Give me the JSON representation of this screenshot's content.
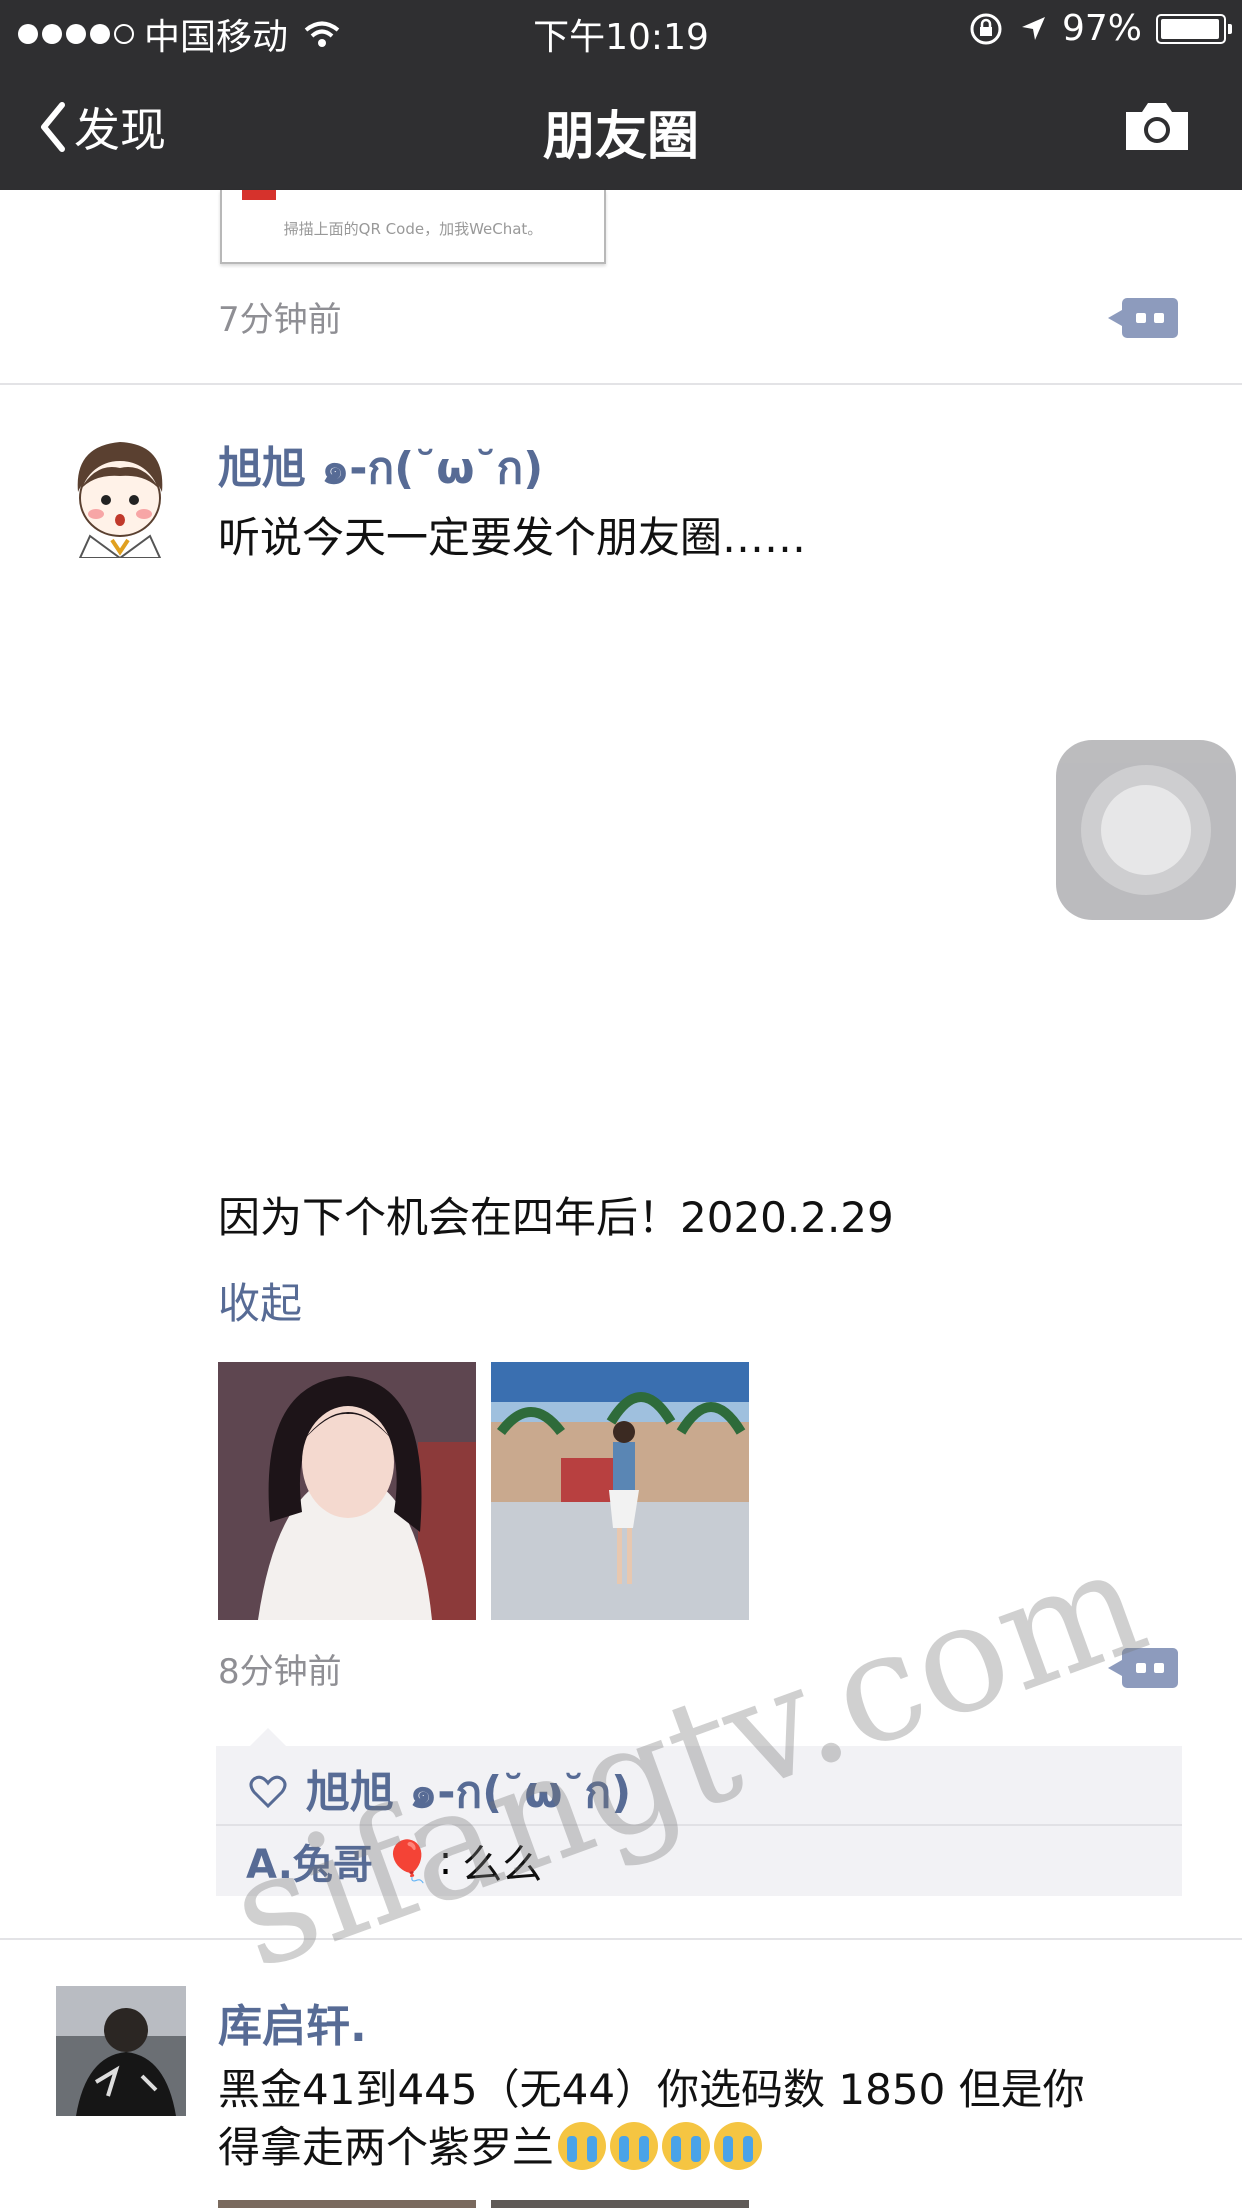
{
  "status_bar": {
    "carrier": "中国移动",
    "time": "下午10:19",
    "battery": "97%",
    "battery_level": 0.97
  },
  "nav": {
    "back_label": "发现",
    "title": "朋友圈"
  },
  "posts": [
    {
      "qr_caption": "掃描上面的QR Code，加我WeChat。",
      "time": "7分钟前"
    },
    {
      "author": "旭旭 ๑-ก(˘ω˘ก)",
      "text_line1": "听说今天一定要发个朋友圈……",
      "text_line2": "因为下个机会在四年后！2020.2.29",
      "collapse_label": "收起",
      "time": "8分钟前",
      "likes": "旭旭 ๑-ก(˘ω˘ก)",
      "comments": [
        {
          "author": "A.兔哥",
          "emoji": "🎈",
          "separator": ":",
          "text": "么么"
        }
      ]
    },
    {
      "author": "库启轩.",
      "text_line1": "黑金41到445（无44）你选码数 1850 但是你",
      "text_line2": "得拿走两个紫罗兰"
    }
  ],
  "watermark": "sifangtv.com",
  "icons": {
    "back": "chevron-left-icon",
    "camera": "camera-icon",
    "comment": "comment-bubble-icon",
    "like": "heart-icon",
    "assistive": "assistive-touch-icon"
  },
  "colors": {
    "nav_bg": "#2f2f31",
    "name": "#576b95",
    "comment_bg": "#f2f2f5"
  }
}
